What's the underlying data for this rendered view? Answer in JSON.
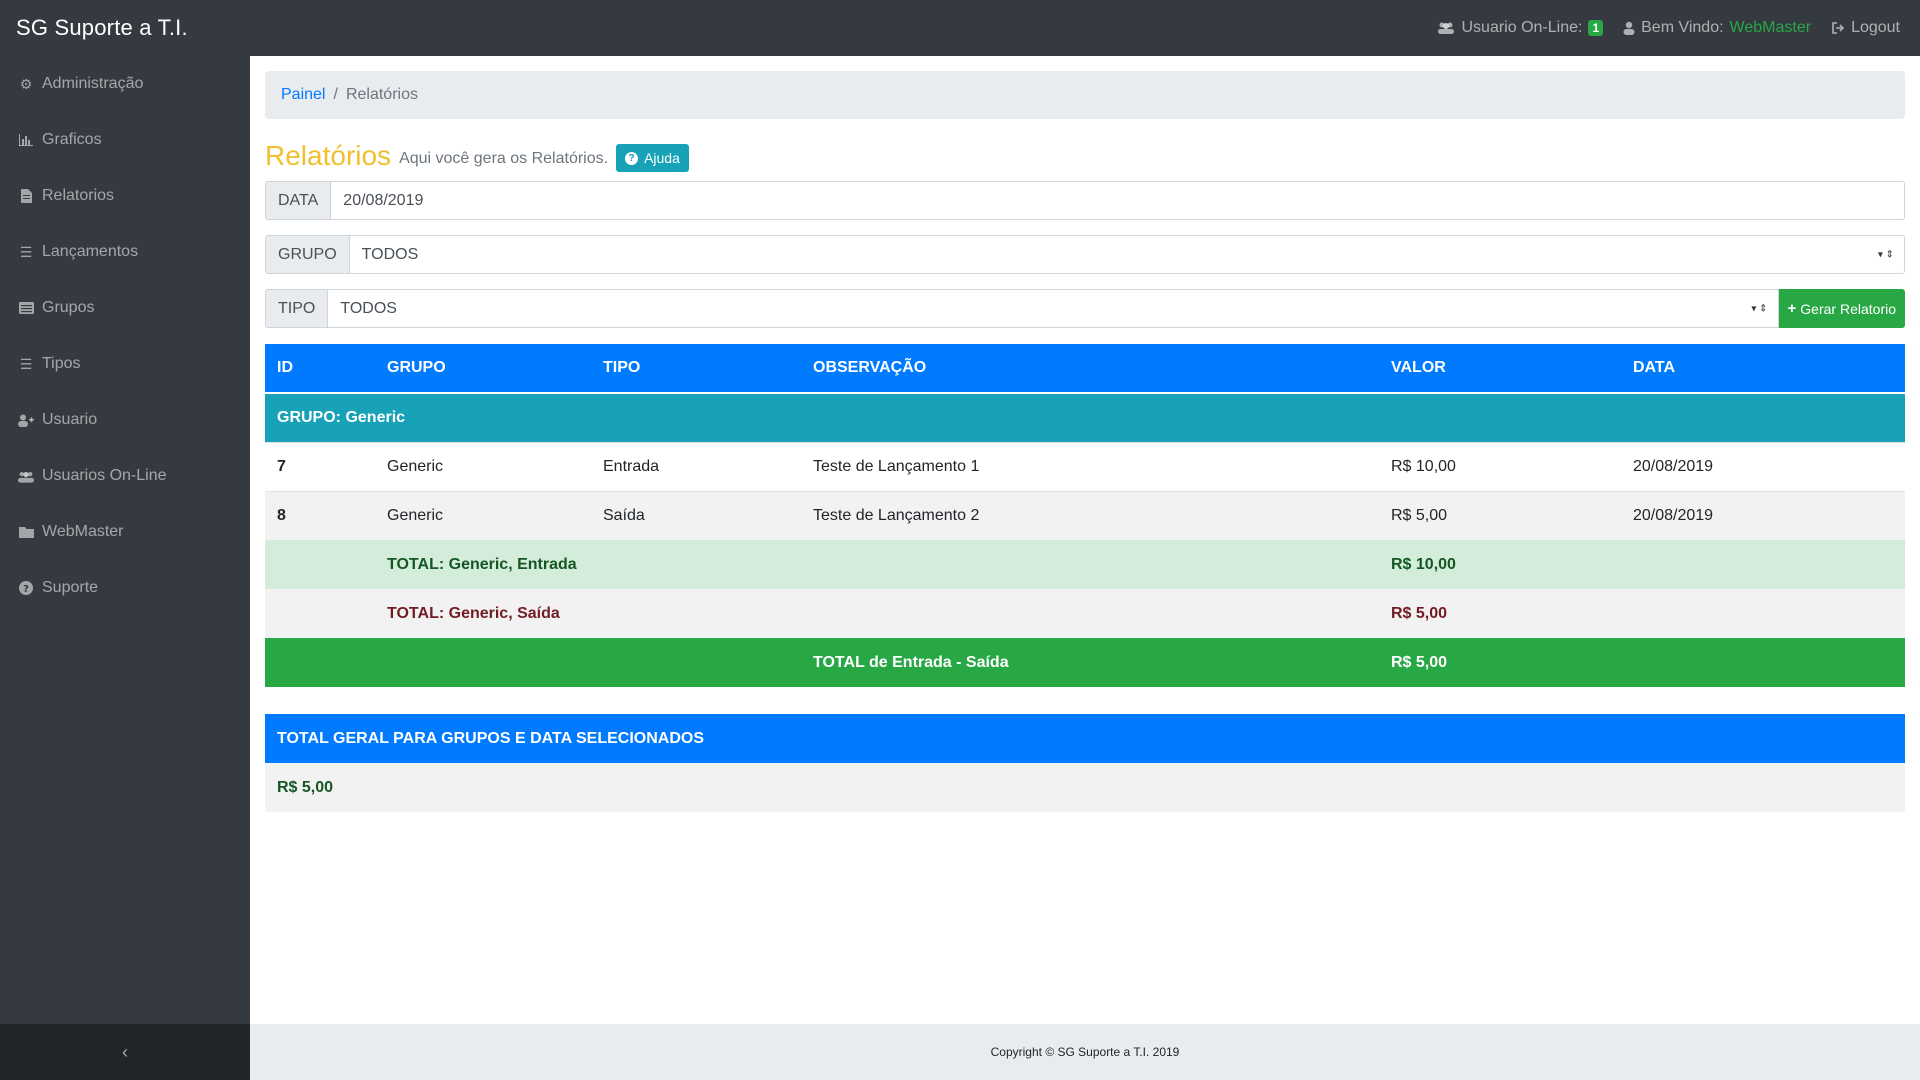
{
  "app": {
    "brand": "SG Suporte a T.I.",
    "online_label": "Usuario On-Line:",
    "online_count": "1",
    "welcome_label": "Bem Vindo:",
    "welcome_user": "WebMaster",
    "logout_label": "Logout"
  },
  "sidebar": {
    "items": [
      {
        "label": "Administração",
        "icon": "gears-icon"
      },
      {
        "label": "Graficos",
        "icon": "bar-chart-icon"
      },
      {
        "label": "Relatorios",
        "icon": "file-icon"
      },
      {
        "label": "Lançamentos",
        "icon": "list-icon"
      },
      {
        "label": "Grupos",
        "icon": "list-alt-icon"
      },
      {
        "label": "Tipos",
        "icon": "list-icon"
      },
      {
        "label": "Usuario",
        "icon": "user-plus-icon"
      },
      {
        "label": "Usuarios On-Line",
        "icon": "users-icon"
      },
      {
        "label": "WebMaster",
        "icon": "folder-icon"
      },
      {
        "label": "Suporte",
        "icon": "question-circle-icon"
      }
    ],
    "toggle_glyph": "‹"
  },
  "breadcrumb": {
    "home": "Painel",
    "separator": "/",
    "current": "Relatórios"
  },
  "page": {
    "title": "Relatórios",
    "subtitle": "Aqui você gera os Relatórios.",
    "help_label": "Ajuda"
  },
  "filters": {
    "data_label": "DATA",
    "data_value": "20/08/2019",
    "grupo_label": "GRUPO",
    "grupo_value": "TODOS",
    "tipo_label": "TIPO",
    "tipo_value": "TODOS",
    "gerar_label": "Gerar Relatorio"
  },
  "report": {
    "headers": {
      "id": "ID",
      "grupo": "GRUPO",
      "tipo": "TIPO",
      "obs": "OBSERVAÇÃO",
      "valor": "VALOR",
      "data": "DATA"
    },
    "group_title": "GRUPO: Generic",
    "rows": [
      {
        "id": "7",
        "grupo": "Generic",
        "tipo": "Entrada",
        "obs": "Teste de Lançamento 1",
        "valor": "R$ 10,00",
        "data": "20/08/2019"
      },
      {
        "id": "8",
        "grupo": "Generic",
        "tipo": "Saída",
        "obs": "Teste de Lançamento 2",
        "valor": "R$ 5,00",
        "data": "20/08/2019"
      }
    ],
    "total_entrada_label": "TOTAL: Generic, Entrada",
    "total_entrada_value": "R$ 10,00",
    "total_saida_label": "TOTAL: Generic, Saída",
    "total_saida_value": "R$ 5,00",
    "net_label": "TOTAL de Entrada - Saída",
    "net_value": "R$ 5,00"
  },
  "summary": {
    "title": "TOTAL GERAL PARA GRUPOS E DATA SELECIONADOS",
    "value": "R$ 5,00"
  },
  "footer": {
    "copyright": "Copyright © SG Suporte a T.I. 2019"
  },
  "colors": {
    "navbar": "#343a40",
    "primary": "#007bff",
    "info": "#17a2b8",
    "success": "#28a745",
    "title": "#f0c030"
  }
}
